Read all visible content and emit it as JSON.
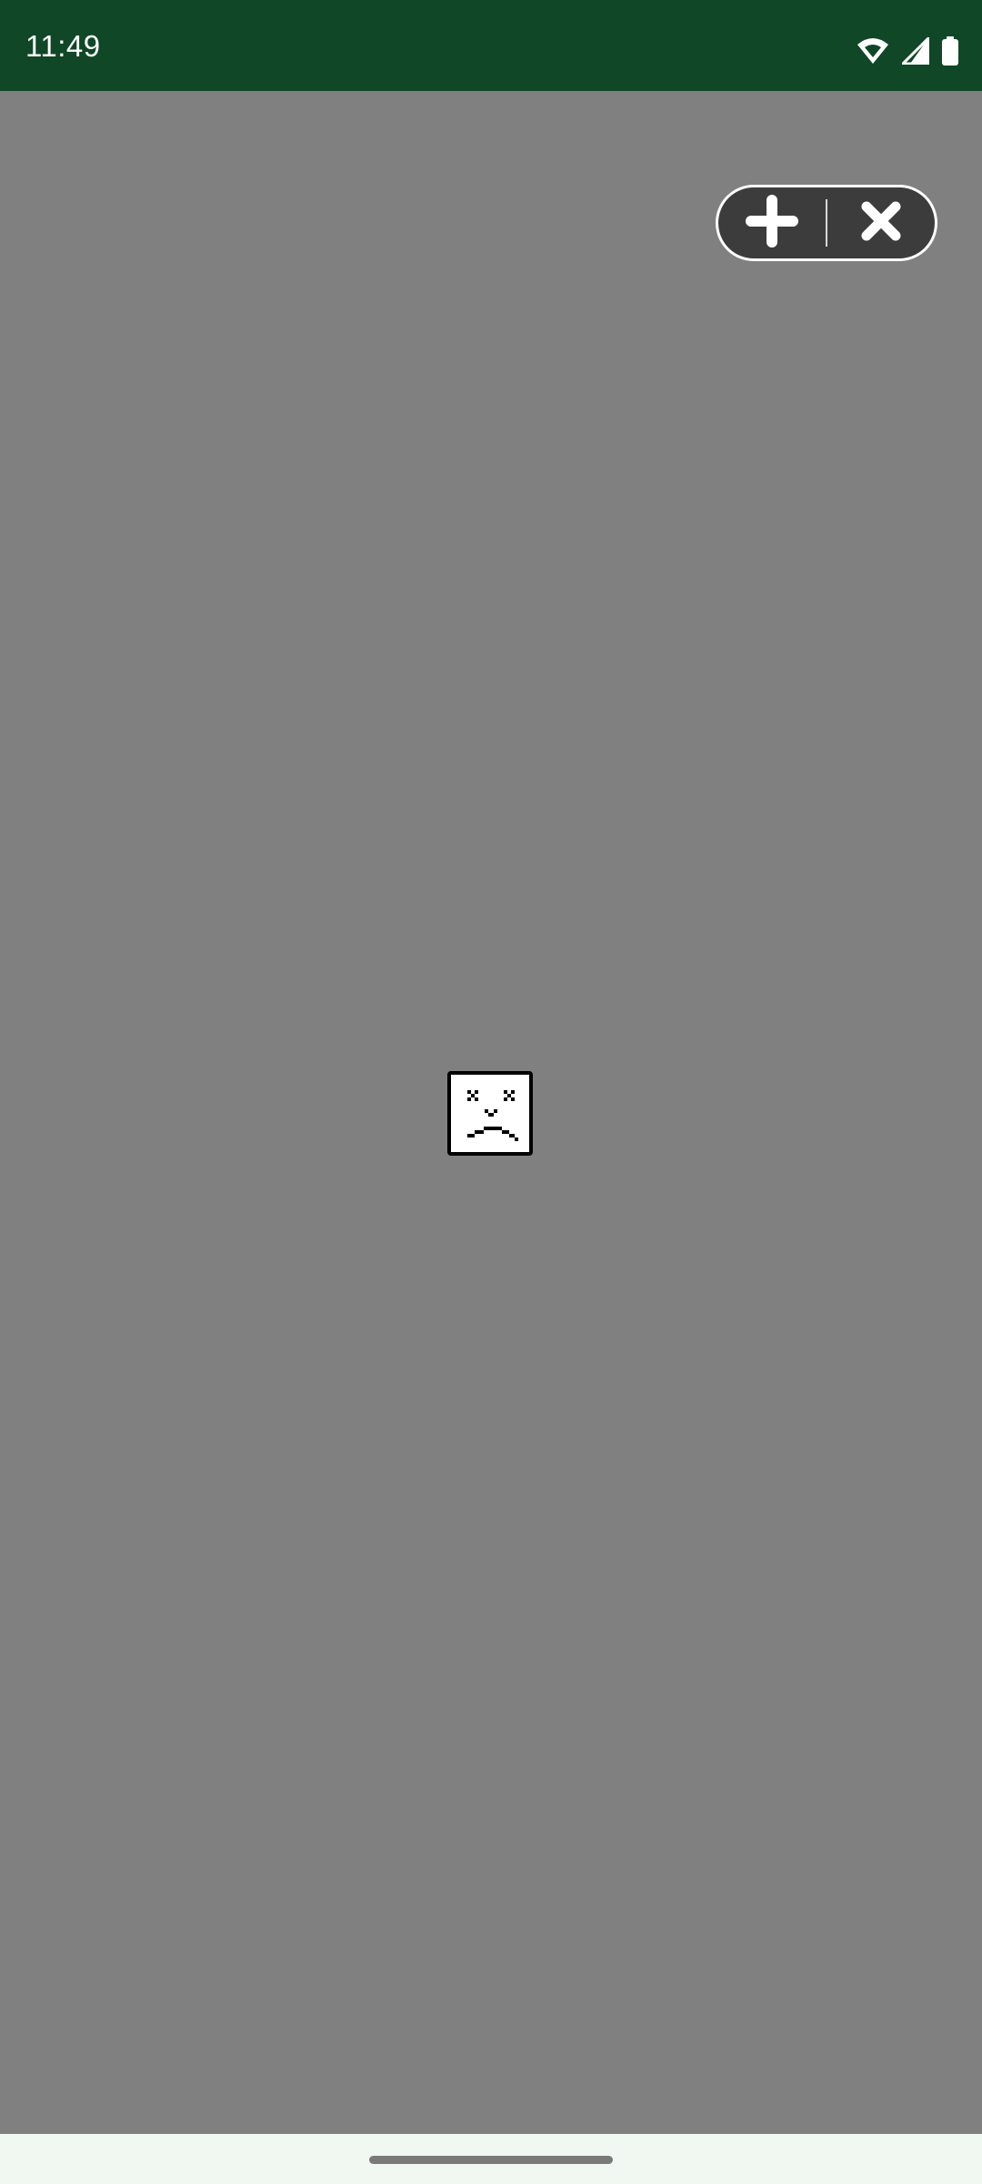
{
  "status_bar": {
    "time": "11:49",
    "background": "#0f4727",
    "icons": [
      "wifi-icon",
      "signal-icon",
      "battery-icon"
    ]
  },
  "overlay_controls": {
    "add_icon": "plus-icon",
    "close_icon": "close-icon"
  },
  "content": {
    "background": "#808080",
    "image_state": "broken-image-icon"
  }
}
